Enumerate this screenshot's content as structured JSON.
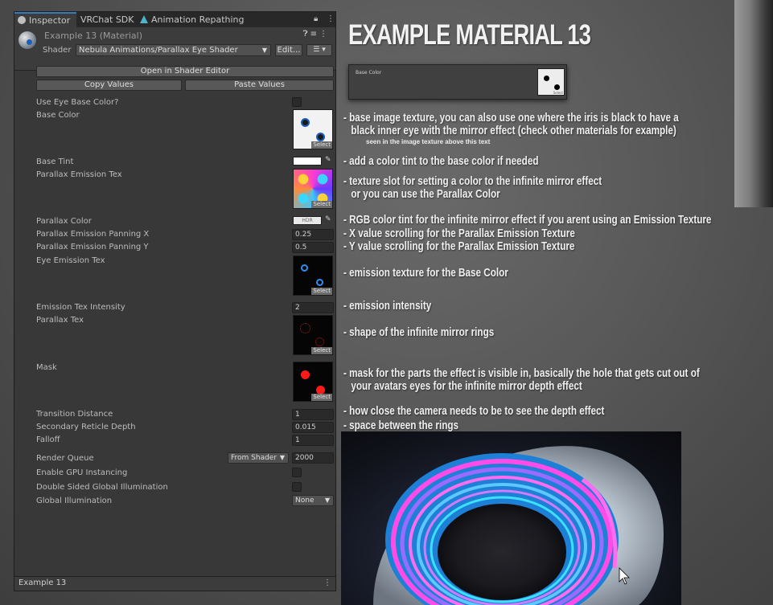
{
  "tabs": {
    "inspector": "Inspector",
    "vrchat_sdk": "VRChat SDK",
    "animation_repathing": "Animation Repathing"
  },
  "header": {
    "material_title": "Example 13 (Material)",
    "shader_label": "Shader",
    "shader_value": "Nebula Animations/Parallax Eye Shader",
    "edit_button": "Edit..."
  },
  "buttons": {
    "open_in_shader_editor": "Open in Shader Editor",
    "copy_values": "Copy Values",
    "paste_values": "Paste Values"
  },
  "properties": {
    "use_eye_base_color": "Use Eye Base Color?",
    "base_color": "Base Color",
    "base_tint": "Base Tint",
    "parallax_emission_tex": "Parallax Emission Tex",
    "parallax_color": "Parallax Color",
    "parallax_color_badge": "HDR",
    "parallax_emission_panning_x": "Parallax Emission Panning X",
    "parallax_emission_panning_x_value": "0.25",
    "parallax_emission_panning_y": "Parallax Emission Panning Y",
    "parallax_emission_panning_y_value": "0.5",
    "eye_emission_tex": "Eye Emission Tex",
    "emission_tex_intensity": "Emission Tex Intensity",
    "emission_tex_intensity_value": "2",
    "parallax_tex": "Parallax Tex",
    "mask": "Mask",
    "transition_distance": "Transition Distance",
    "transition_distance_value": "1",
    "secondary_reticle_depth": "Secondary Reticle Depth",
    "secondary_reticle_depth_value": "0.015",
    "falloff": "Falloff",
    "falloff_value": "1",
    "render_queue": "Render Queue",
    "render_queue_mode": "From Shader",
    "render_queue_value": "2000",
    "enable_gpu_instancing": "Enable GPU Instancing",
    "double_sided_gi": "Double Sided Global Illumination",
    "global_illumination": "Global Illumination",
    "global_illumination_value": "None",
    "select_label": "Select"
  },
  "footer": {
    "preview_title": "Example 13"
  },
  "annotations": {
    "title": "EXAMPLE MATERIAL 13",
    "preview_label": "Base Color",
    "preview_select": "Select",
    "base_texture_line1": "- base image texture, you can also use one where the iris is black to have a",
    "base_texture_line2": "black inner eye with the mirror effect (check other materials for example)",
    "base_texture_small": "seen in the image texture above this text",
    "base_tint": "- add a color tint to the base color if needed",
    "parallax_emission_line1": "- texture slot for setting a color to the infinite mirror effect",
    "parallax_emission_line2": "or you can use the Parallax Color",
    "parallax_color": "- RGB color tint for the infinite mirror effect if you arent using an Emission Texture",
    "panning_x": "- X  value scrolling for the Parallax Emission Texture",
    "panning_y": "- Y value scrolling for the Parallax Emission Texture",
    "eye_emission": "- emission texture for the Base Color",
    "emission_intensity": "- emission intensity",
    "parallax_tex": "- shape of the infinite mirror rings",
    "mask_line1": "- mask for the parts the effect is visible in, basically the hole that gets cut out of",
    "mask_line2": "your avatars eyes for the infinite mirror depth effect",
    "transition_distance": "- how close the camera needs to be to see the depth effect",
    "reticle_depth": "- space between the rings"
  },
  "colors": {
    "tab_accent": "#3a79bb",
    "base_tint_swatch": "#ffffff",
    "mask_dot": "#ff1a1a",
    "eye_dot": "#1a5fb8"
  }
}
